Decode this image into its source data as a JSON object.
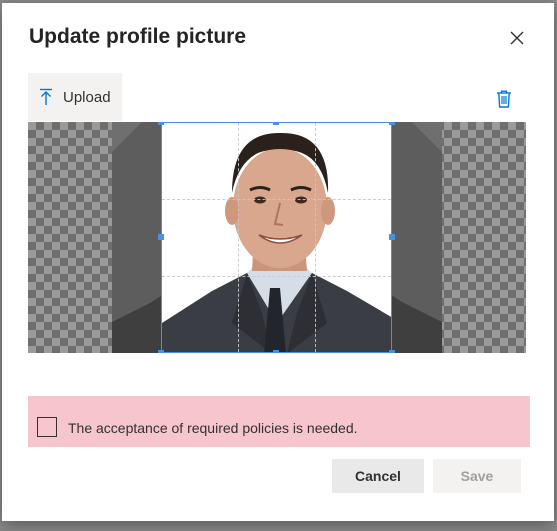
{
  "dialog": {
    "title": "Update profile picture",
    "close_icon": "close-icon"
  },
  "toolbar": {
    "upload_label": "Upload",
    "upload_icon": "upload-arrow-icon",
    "delete_icon": "trash-icon"
  },
  "policy": {
    "message": "The acceptance of required policies is needed.",
    "checked": false,
    "background": "#f6c6cc"
  },
  "footer": {
    "cancel_label": "Cancel",
    "save_label": "Save",
    "save_disabled": true
  },
  "colors": {
    "accent": "#4a90e2",
    "icon_blue": "#0078d4"
  }
}
